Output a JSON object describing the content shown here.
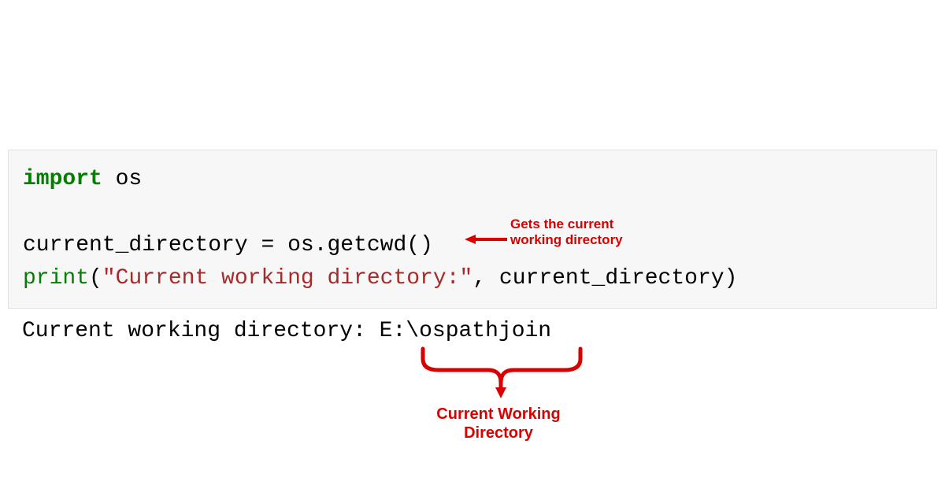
{
  "code": {
    "import_kw": "import",
    "import_module": " os",
    "blank": "",
    "line3_var": "current_directory ",
    "line3_eq": "= ",
    "line3_call": "os.getcwd()",
    "line4_fn": "print",
    "line4_open": "(",
    "line4_str": "\"Current working directory:\"",
    "line4_comma": ", ",
    "line4_arg": "current_directory)",
    "spacing_line": " "
  },
  "output": {
    "text": "Current working directory: E:\\ospathjoin"
  },
  "annotations": {
    "arrow_label_line1": "Gets the current",
    "arrow_label_line2": "working directory",
    "brace_label_line1": "Current Working",
    "brace_label_line2": "Directory"
  },
  "colors": {
    "annotation_red": "#d90000",
    "code_bg": "#f7f7f7"
  }
}
